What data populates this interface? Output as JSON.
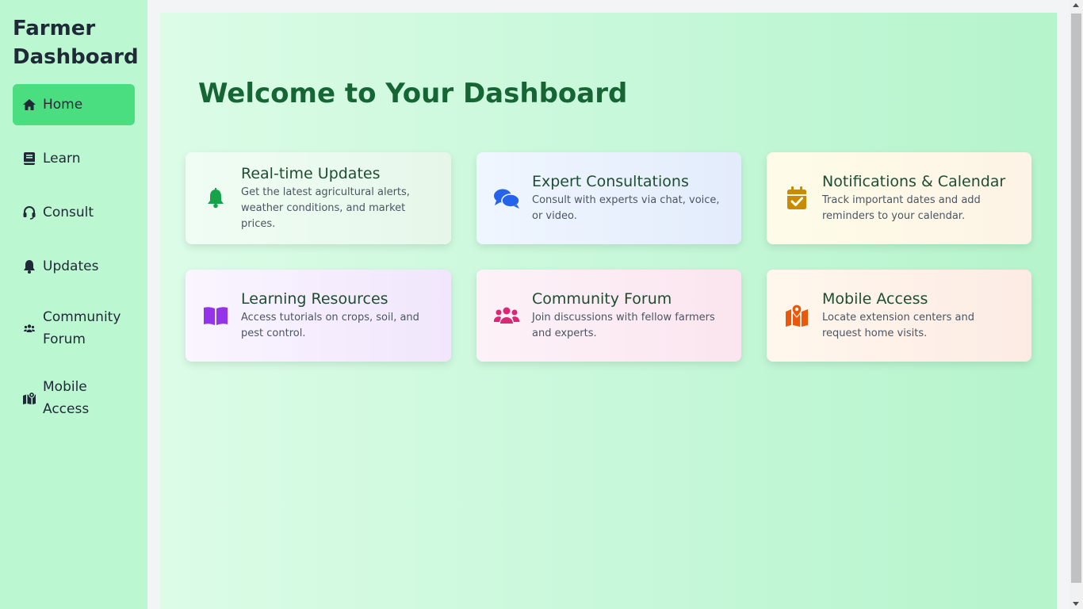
{
  "sidebar": {
    "brand": "Farmer Dashboard",
    "items": [
      {
        "label": "Home",
        "icon": "home-icon",
        "active": true
      },
      {
        "label": "Learn",
        "icon": "book-icon"
      },
      {
        "label": "Consult",
        "icon": "headset-icon"
      },
      {
        "label": "Updates",
        "icon": "bell-icon"
      },
      {
        "label": "Community Forum",
        "icon": "users-icon"
      },
      {
        "label": "Mobile Access",
        "icon": "map-marker-icon"
      }
    ]
  },
  "main": {
    "title": "Welcome to Your Dashboard",
    "cards": [
      {
        "title": "Real-time Updates",
        "description": "Get the latest agricultural alerts, weather conditions, and market prices.",
        "icon": "bell-icon",
        "color": "#16a34a"
      },
      {
        "title": "Expert Consultations",
        "description": "Consult with experts via chat, voice, or video.",
        "icon": "chat-icon",
        "color": "#2563eb"
      },
      {
        "title": "Notifications & Calendar",
        "description": "Track important dates and add reminders to your calendar.",
        "icon": "calendar-check-icon",
        "color": "#ca8a04"
      },
      {
        "title": "Learning Resources",
        "description": "Access tutorials on crops, soil, and pest control.",
        "icon": "book-open-icon",
        "color": "#9333ea"
      },
      {
        "title": "Community Forum",
        "description": "Join discussions with fellow farmers and experts.",
        "icon": "users-icon",
        "color": "#db2777"
      },
      {
        "title": "Mobile Access",
        "description": "Locate extension centers and request home visits.",
        "icon": "map-location-icon",
        "color": "#ea580c"
      }
    ]
  },
  "colors": {
    "sidebar_bg": "#bbf7d0",
    "active_item": "#4ade80",
    "title_green": "#166534"
  }
}
